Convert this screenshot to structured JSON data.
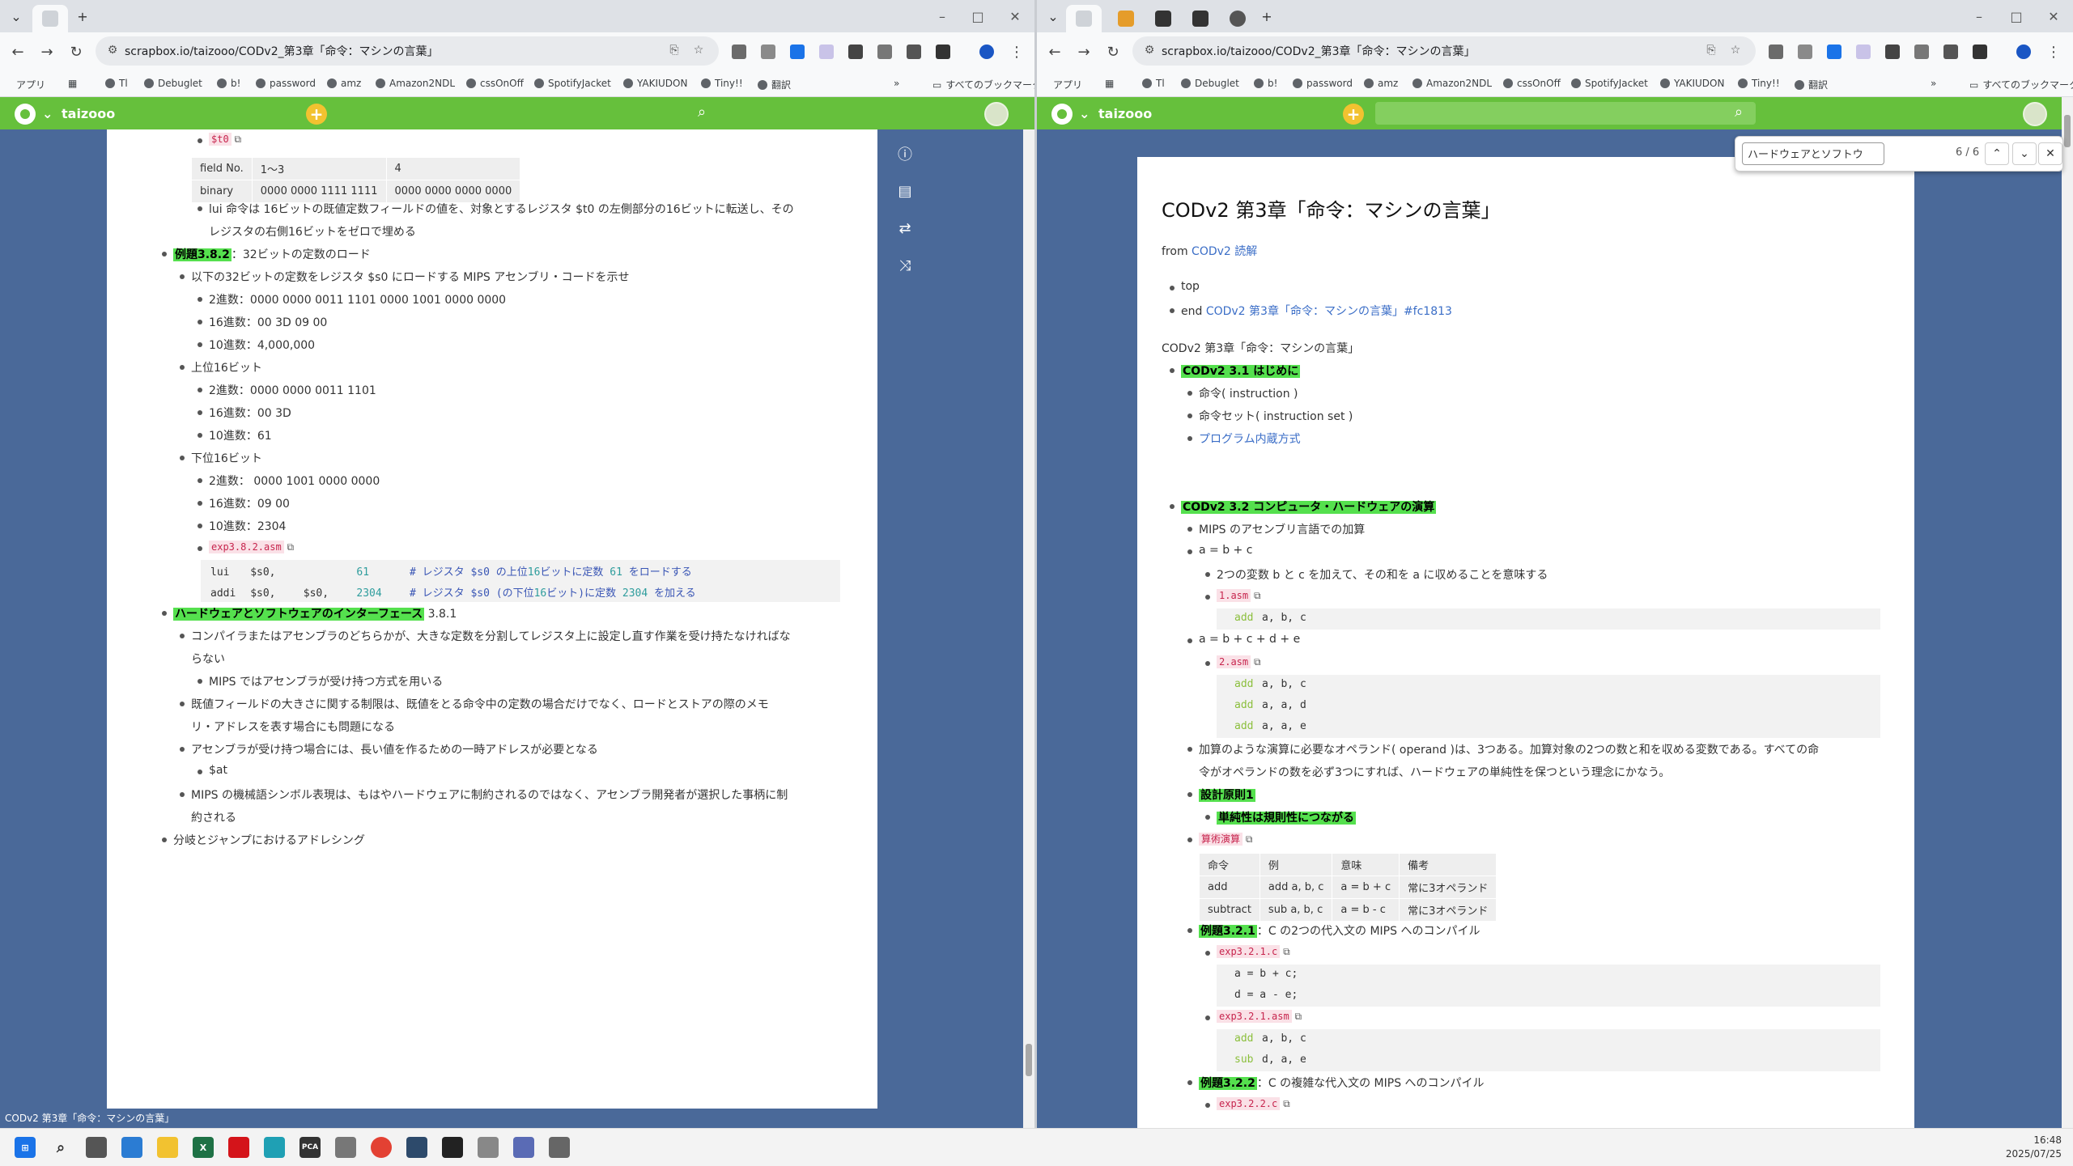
{
  "browser": {
    "url": "scrapbox.io/taizooo/CODv2_第3章「命令：マシンの言葉」",
    "bookmarks": [
      "アプリ",
      "Tl",
      "Debuglet",
      "b!",
      "password",
      "amz",
      "Amazon2NDL",
      "cssOnOff",
      "SpotifyJacket",
      "YAKIUDON",
      "Tiny!!",
      "翻訳"
    ],
    "all_bookmarks": "すべてのブックマーク"
  },
  "scrapbox": {
    "project": "taizooo"
  },
  "left": {
    "lines": [
      {
        "t": "$t0",
        "d": 2,
        "style": "codefile"
      },
      {
        "t": "lui 命令は 16ビットの既値定数フィールドの値を、対象とするレジスタ $t0 の左側部分の16ビットに転送し、その",
        "d": 2
      },
      {
        "t": "レジスタの右側16ビットをゼロで埋める",
        "d": 2,
        "cont": true
      },
      {
        "t": "例題3.8.2",
        "d": 0,
        "hl": true,
        "rest": "：32ビットの定数のロード"
      },
      {
        "t": "以下の32ビットの定数をレジスタ $s0 にロードする MIPS アセンブリ・コードを示せ",
        "d": 1
      },
      {
        "t": "2進数：0000 0000 0011 1101 0000 1001 0000 0000",
        "d": 2
      },
      {
        "t": "16進数：00 3D 09 00",
        "d": 2
      },
      {
        "t": "10進数：4,000,000",
        "d": 2
      },
      {
        "t": "上位16ビット",
        "d": 1
      },
      {
        "t": "2進数：0000 0000 0011 1101",
        "d": 2
      },
      {
        "t": "16進数：00 3D",
        "d": 2
      },
      {
        "t": "10進数：61",
        "d": 2
      },
      {
        "t": "下位16ビット",
        "d": 1
      },
      {
        "t": "2進数： 0000 1001 0000 0000",
        "d": 2
      },
      {
        "t": "16進数：09 00",
        "d": 2
      },
      {
        "t": "10進数：2304",
        "d": 2
      },
      {
        "t": "exp3.8.2.asm",
        "d": 2,
        "style": "codefile"
      },
      {
        "t": "ハードウェアとソフトウェアのインターフェース",
        "d": 0,
        "hl": true,
        "rest": " 3.8.1"
      },
      {
        "t": "コンパイラまたはアセンブラのどちらかが、大きな定数を分割してレジスタ上に設定し直す作業を受け持たなければな",
        "d": 1
      },
      {
        "t": "らない",
        "d": 1,
        "cont": true
      },
      {
        "t": "MIPS ではアセンブラが受け持つ方式を用いる",
        "d": 2
      },
      {
        "t": "既値フィールドの大きさに関する制限は、既値をとる命令中の定数の場合だけでなく、ロードとストアの際のメモ",
        "d": 1
      },
      {
        "t": "リ・アドレスを表す場合にも問題になる",
        "d": 1,
        "cont": true
      },
      {
        "t": "アセンブラが受け持つ場合には、長い値を作るための一時アドレスが必要となる",
        "d": 1
      },
      {
        "t": "$at",
        "d": 2
      },
      {
        "t": "MIPS の機械語シンボル表現は、もはやハードウェアに制約されるのではなく、アセンブラ開発者が選択した事柄に制",
        "d": 1
      },
      {
        "t": "約される",
        "d": 1,
        "cont": true
      },
      {
        "t": "分岐とジャンプにおけるアドレシング",
        "d": 0
      }
    ],
    "field_table": [
      [
        "field No.",
        "1～3",
        "4"
      ],
      [
        "binary",
        "0000 0000 1111 1111",
        "0000 0000 0000 0000"
      ]
    ],
    "code_lui": {
      "op": "lui",
      "a": "$s0,",
      "b": "",
      "imm": "61",
      "cm1": "# レジスタ $s0 の上位",
      "cm2": "16",
      "cm3": "ビットに定数 ",
      "cm4": "61",
      "cm5": " をロードする"
    },
    "code_addi": {
      "op": "addi",
      "a": "$s0,",
      "b": "$s0,",
      "imm": "2304",
      "cm1": "# レジスタ $s0 (の下位",
      "cm2": "16",
      "cm3": "ビット)に定数 ",
      "cm4": "2304",
      "cm5": " を加える"
    },
    "status": "CODv2 第3章「命令：マシンの言葉」"
  },
  "right": {
    "title": "CODv2 第3章「命令：マシンの言葉」",
    "from_label": "from",
    "from_link": "CODv2 読解",
    "find": {
      "query": "ハードウェアとソフトウ",
      "count": "6 / 6"
    },
    "lines": [
      {
        "t": "top",
        "d": 0
      },
      {
        "t": "end",
        "d": 0,
        "link": "CODv2 第3章「命令：マシンの言葉」#fc1813"
      },
      {
        "t": "CODv2 第3章「命令：マシンの言葉」",
        "d": -1
      },
      {
        "t": "CODv2 3.1 はじめに",
        "d": 0,
        "hl": true
      },
      {
        "t": "命令( instruction )",
        "d": 1
      },
      {
        "t": "命令セット( instruction set )",
        "d": 1
      },
      {
        "t": "プログラム内蔵方式",
        "d": 1,
        "linkonly": true
      },
      {
        "t": "CODv2 3.2 コンピュータ・ハードウェアの演算",
        "d": 0,
        "hl": true
      },
      {
        "t": "MIPS のアセンブリ言語での加算",
        "d": 1
      },
      {
        "t": "a = b + c",
        "d": 1
      },
      {
        "t": "2つの変数 b と c を加えて、その和を a に収めることを意味する",
        "d": 2
      },
      {
        "t": "1.asm",
        "d": 2,
        "style": "codefile"
      },
      {
        "t": "a = b + c + d + e",
        "d": 1
      },
      {
        "t": "2.asm",
        "d": 2,
        "style": "codefile"
      },
      {
        "t": "加算のような演算に必要なオペランド( operand )は、3つある。加算対象の2つの数と和を収める変数である。すべての命",
        "d": 1
      },
      {
        "t": "令がオペランドの数を必ず3つにすれば、ハードウェアの単純性を保つという理念にかなう。",
        "d": 1,
        "cont": true
      },
      {
        "t": "設計原則1",
        "d": 1,
        "hl": true
      },
      {
        "t": "単純性は規則性につながる",
        "d": 2,
        "hl": true
      },
      {
        "t": "算術演算",
        "d": 1,
        "style": "codefile"
      },
      {
        "t": "例題3.2.1",
        "d": 1,
        "hl": true,
        "rest": "：C の2つの代入文の MIPS へのコンパイル"
      },
      {
        "t": "exp3.2.1.c",
        "d": 2,
        "style": "codefile"
      },
      {
        "t": "exp3.2.1.asm",
        "d": 2,
        "style": "codefile"
      },
      {
        "t": "例題3.2.2",
        "d": 1,
        "hl": true,
        "rest": "：C の複雑な代入文の MIPS へのコンパイル"
      },
      {
        "t": "exp3.2.2.c",
        "d": 2,
        "style": "codefile"
      }
    ],
    "code_1asm": [
      "add",
      "a, b, c"
    ],
    "code_2asm": [
      [
        "add",
        "a, b, c"
      ],
      [
        "add",
        "a, a, d"
      ],
      [
        "add",
        "a, a, e"
      ]
    ],
    "arith_table": [
      [
        "命令",
        "例",
        "意味",
        "備考"
      ],
      [
        "add",
        "add a, b, c",
        "a = b + c",
        "常に3オペランド"
      ],
      [
        "subtract",
        "sub a, b, c",
        "a = b - c",
        "常に3オペランド"
      ]
    ],
    "code_c": [
      "a = b + c;",
      "d = a - e;"
    ],
    "code_asm": [
      [
        "add",
        "a, b, c"
      ],
      [
        "sub",
        "d, a, e"
      ]
    ]
  },
  "clock": {
    "time": "16:48",
    "date": "2025/07/25"
  }
}
